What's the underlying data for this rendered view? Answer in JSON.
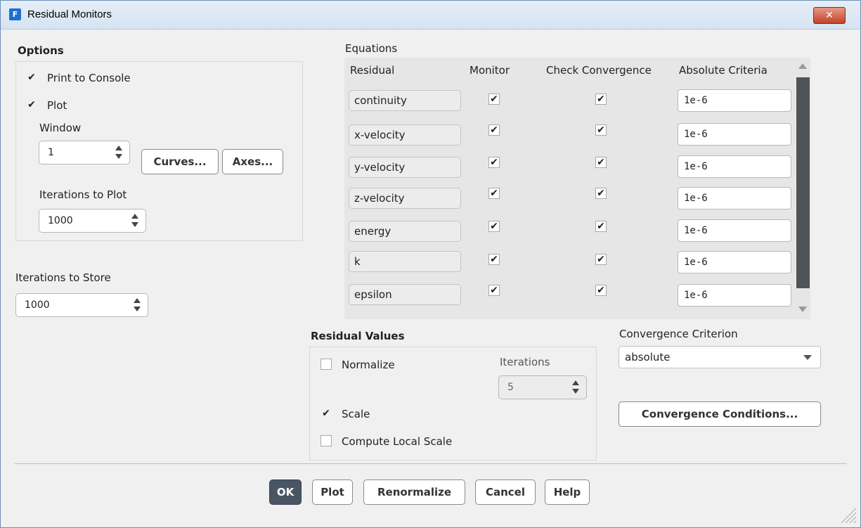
{
  "window": {
    "title": "Residual Monitors",
    "app_icon": "F",
    "close": "✕"
  },
  "options": {
    "heading": "Options",
    "print_to_console": {
      "label": "Print to Console",
      "checked": true
    },
    "plot": {
      "label": "Plot",
      "checked": true
    },
    "window_label": "Window",
    "window_value": "1",
    "curves_button": "Curves...",
    "axes_button": "Axes...",
    "iterations_to_plot_label": "Iterations to Plot",
    "iterations_to_plot_value": "1000"
  },
  "store": {
    "label": "Iterations to Store",
    "value": "1000"
  },
  "equations": {
    "heading": "Equations",
    "columns": [
      "Residual",
      "Monitor",
      "Check Convergence",
      "Absolute Criteria"
    ],
    "rows": [
      {
        "residual": "continuity",
        "monitor": true,
        "check": true,
        "criteria": "1e-6"
      },
      {
        "residual": "x-velocity",
        "monitor": true,
        "check": true,
        "criteria": "1e-6"
      },
      {
        "residual": "y-velocity",
        "monitor": true,
        "check": true,
        "criteria": "1e-6"
      },
      {
        "residual": "z-velocity",
        "monitor": true,
        "check": true,
        "criteria": "1e-6"
      },
      {
        "residual": "energy",
        "monitor": true,
        "check": true,
        "criteria": "1e-6"
      },
      {
        "residual": "k",
        "monitor": true,
        "check": true,
        "criteria": "1e-6"
      },
      {
        "residual": "epsilon",
        "monitor": true,
        "check": true,
        "criteria": "1e-6"
      }
    ]
  },
  "residual_values": {
    "heading": "Residual Values",
    "normalize": {
      "label": "Normalize",
      "checked": false
    },
    "iterations_label": "Iterations",
    "iterations_value": "5",
    "scale": {
      "label": "Scale",
      "checked": true
    },
    "compute_local_scale": {
      "label": "Compute Local Scale",
      "checked": false
    }
  },
  "convergence": {
    "criterion_label": "Convergence Criterion",
    "criterion_value": "absolute",
    "conditions_button": "Convergence Conditions..."
  },
  "footer": {
    "ok": "OK",
    "plot": "Plot",
    "renormalize": "Renormalize",
    "cancel": "Cancel",
    "help": "Help"
  },
  "check_glyph": "✔"
}
